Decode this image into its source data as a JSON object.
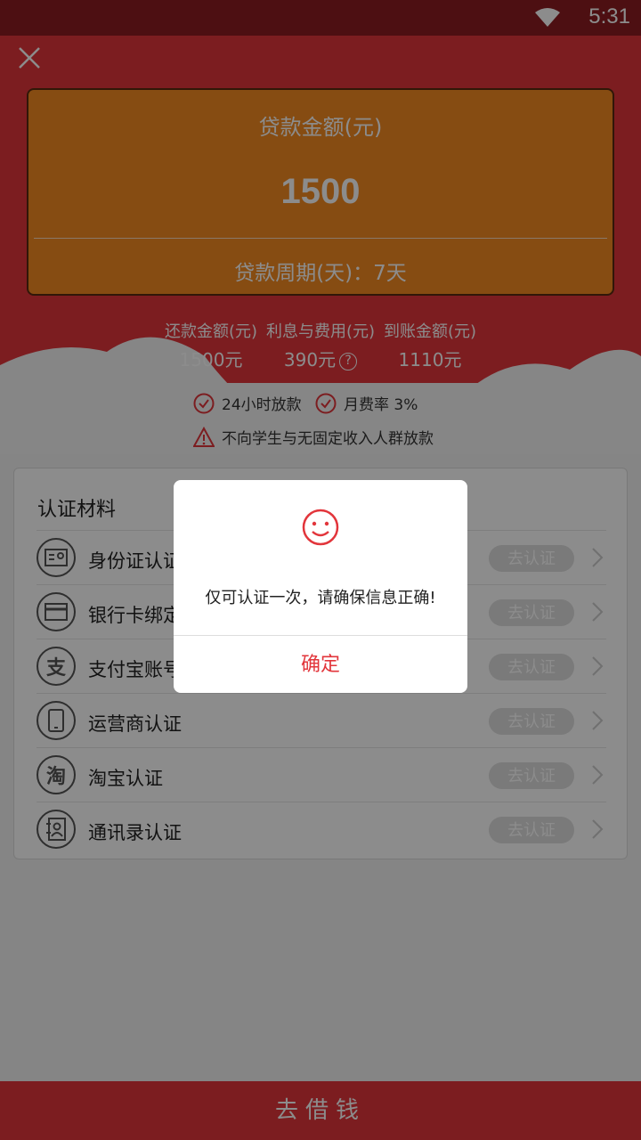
{
  "status_bar": {
    "time": "5:31",
    "wifi_icon": "wifi-icon"
  },
  "header": {
    "close_icon": "close-icon",
    "loan_amount_label": "贷款金额(元)",
    "loan_amount": "1500",
    "loan_period": "贷款周期(天)：7天"
  },
  "summary": {
    "repay_label": "还款金额(元)",
    "repay_value": "1500元",
    "interest_label": "利息与费用(元)",
    "interest_value": "390元",
    "receive_label": "到账金额(元)",
    "receive_value": "1110元",
    "question_icon": "?"
  },
  "features": {
    "fast_loan": "24小时放款",
    "monthly_rate": "月费率 3%",
    "warning": "不向学生与无固定收入人群放款"
  },
  "materials": {
    "title": "认证材料",
    "items": [
      {
        "label": "身份证认证",
        "icon": "id-card-icon",
        "button": "去认证"
      },
      {
        "label": "银行卡绑定",
        "icon": "bank-card-icon",
        "button": "去认证"
      },
      {
        "label": "支付宝账号",
        "icon": "alipay-icon",
        "icon_text": "支",
        "button": "去认证"
      },
      {
        "label": "运营商认证",
        "icon": "phone-icon",
        "button": "去认证"
      },
      {
        "label": "淘宝认证",
        "icon": "taobao-icon",
        "icon_text": "淘",
        "button": "去认证"
      },
      {
        "label": "通讯录认证",
        "icon": "contacts-icon",
        "button": "去认证"
      }
    ]
  },
  "bottom": {
    "borrow_label": "去借钱"
  },
  "dialog": {
    "icon": "smile-icon",
    "message": "仅可认证一次，请确保信息正确!",
    "confirm_label": "确定"
  },
  "colors": {
    "brand_red": "#e2353b",
    "card_orange": "#f48a22"
  }
}
